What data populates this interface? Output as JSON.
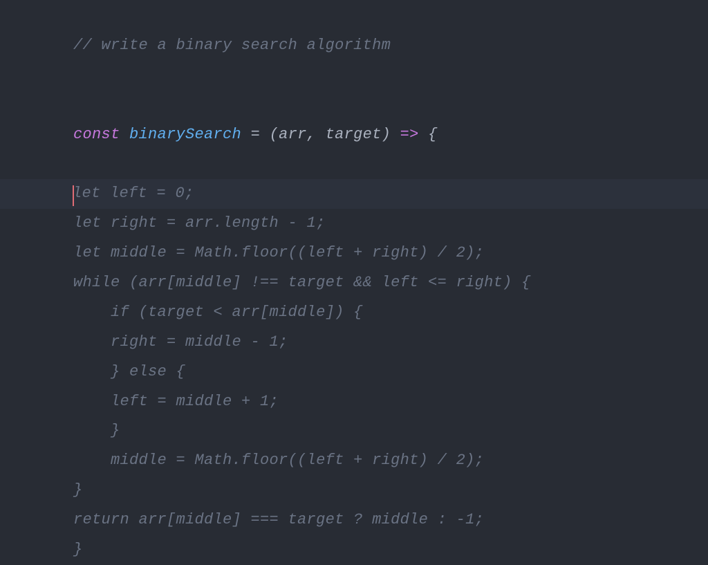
{
  "editor": {
    "comment": "// write a binary search algorithm",
    "signature": {
      "const": "const",
      "funcname": " binarySearch",
      "eq": " = ",
      "open_paren": "(",
      "params": "arr, target",
      "close_paren": ")",
      "arrow": " => ",
      "open_brace": "{"
    },
    "suggestion_lines": [
      "    let left = 0;",
      "    let right = arr.length - 1;",
      "    let middle = Math.floor((left + right) / 2);",
      "    while (arr[middle] !== target && left <= right) {",
      "        if (target < arr[middle]) {",
      "        right = middle - 1;",
      "        } else {",
      "        left = middle + 1;",
      "        }",
      "        middle = Math.floor((left + right) / 2);",
      "    }",
      "    return arr[middle] === target ? middle : -1;",
      "    }"
    ],
    "highlight_index": 0,
    "cursor_line": 0
  }
}
